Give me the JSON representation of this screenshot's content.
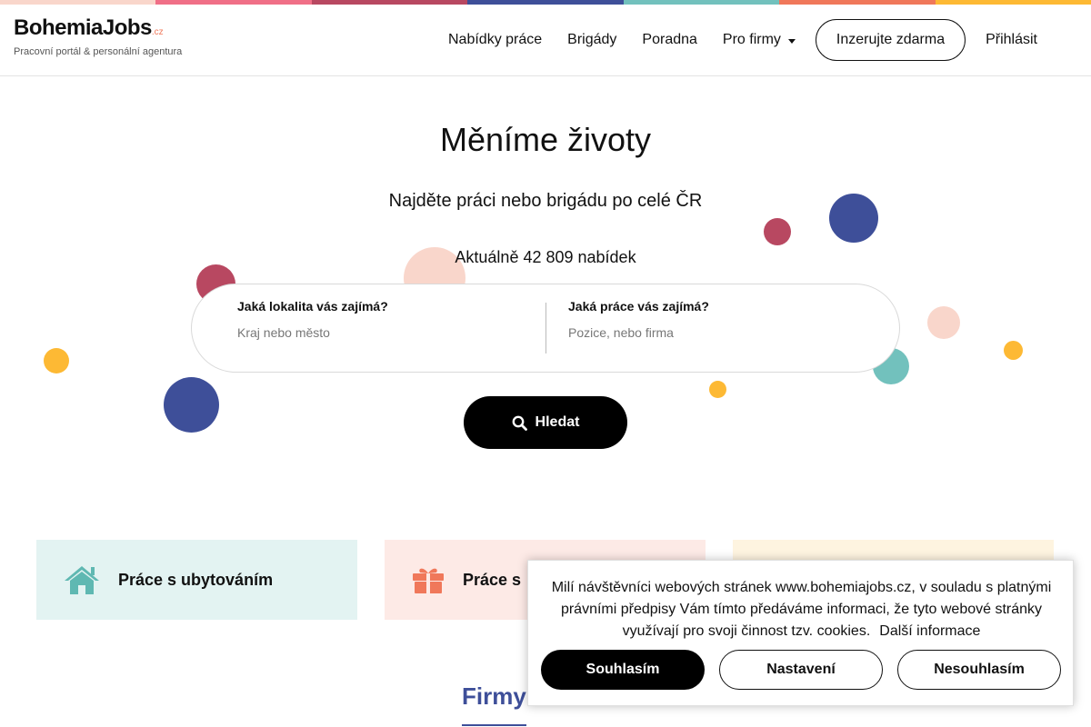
{
  "colors": {
    "stripe": [
      "#f9d6cb",
      "#f06f87",
      "#b84861",
      "#3e4f99",
      "#72c1bd",
      "#f0785a",
      "#fdb934"
    ],
    "navy": "#3e4f99",
    "coral": "#f0785a",
    "teal": "#5fb8b2"
  },
  "header": {
    "logo_text": "BohemiaJobs",
    "logo_tld": ".cz",
    "logo_tagline": "Pracovní portál & personální agentura",
    "nav": {
      "jobs": "Nabídky práce",
      "brigades": "Brigády",
      "advice": "Poradna",
      "companies": "Pro firmy"
    },
    "advertise_button": "Inzerujte zdarma",
    "login": "Přihlásit"
  },
  "hero": {
    "title": "Měníme životy",
    "subtitle": "Najděte práci nebo brigádu po celé ČR",
    "count_text": "Aktuálně 42 809 nabídek"
  },
  "search": {
    "location_label": "Jaká lokalita vás zajímá?",
    "location_placeholder": "Kraj nebo město",
    "job_label": "Jaká práce vás zajímá?",
    "job_placeholder": "Pozice, nebo firma",
    "button_label": "Hledat"
  },
  "categories": [
    {
      "label": "Práce s ubytováním",
      "icon": "home-icon"
    },
    {
      "label": "Práce s ",
      "icon": "gift-icon"
    }
  ],
  "section": {
    "title_visible": "Firmy"
  },
  "cookie": {
    "text": "Milí návštěvníci webových stránek www.bohemiajobs.cz, v souladu s platnými právními předpisy Vám tímto předáváme informaci, že tyto webové stránky využívají pro svoji činnost tzv. cookies.",
    "more_link": "Další informace",
    "accept": "Souhlasím",
    "settings": "Nastavení",
    "decline": "Nesouhlasím"
  }
}
